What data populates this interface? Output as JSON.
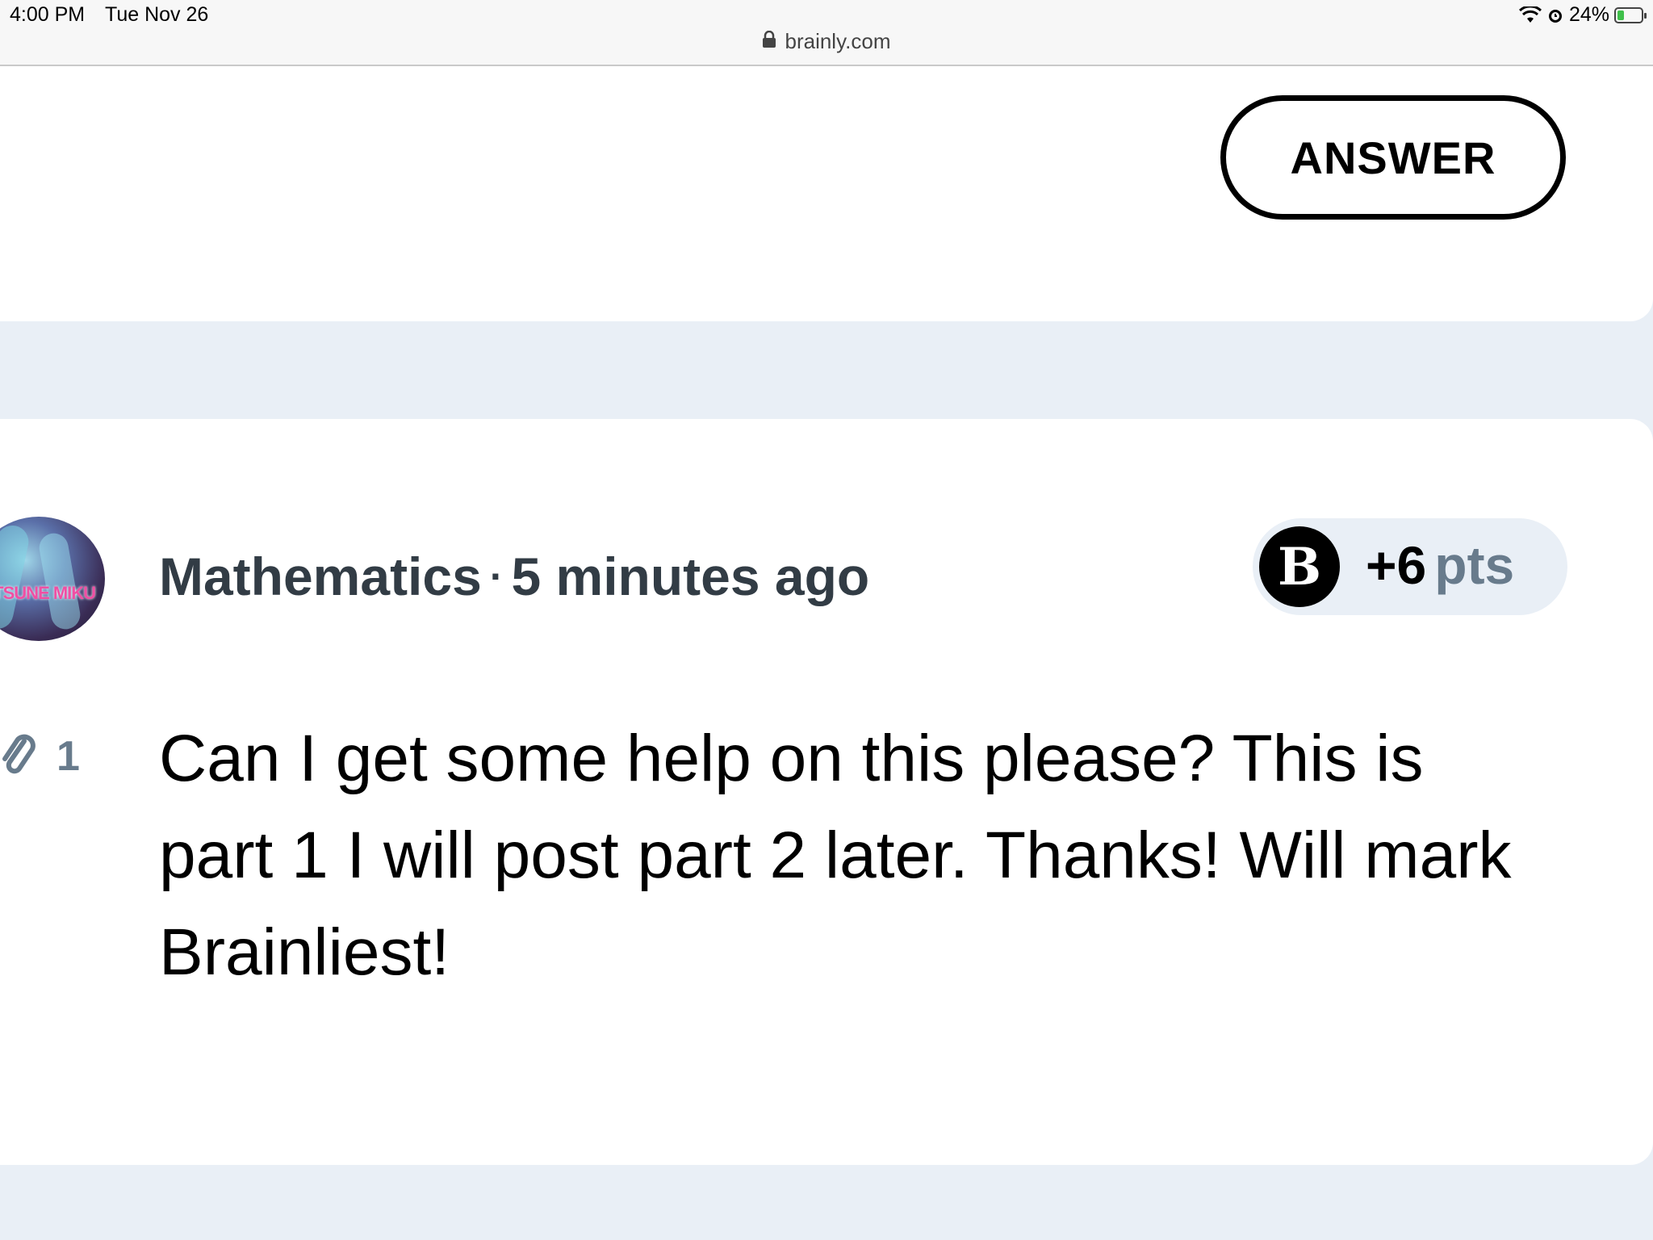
{
  "status_bar": {
    "time": "4:00 PM",
    "date": "Tue Nov 26",
    "battery": "24%",
    "icons": [
      "wifi-icon",
      "alarm-icon",
      "battery-charging-icon"
    ]
  },
  "address_bar": {
    "url": "brainly.com",
    "icon": "lock-icon"
  },
  "top_card": {
    "answer_label": "ANSWER"
  },
  "question": {
    "subject": "Mathematics",
    "separator": "·",
    "time_ago": "5 minutes ago",
    "avatar_text": "ATSUNE MIKU",
    "points_badge_letter": "B",
    "points_value": "+6",
    "points_unit": "pts",
    "attachments_count": "1",
    "text": "Can I get some help on this please? This is part 1 I will post part 2 later. Thanks! Will mark Brainliest!"
  },
  "colors": {
    "background": "#e9eff6",
    "card": "#ffffff",
    "meta_text": "#323c45",
    "muted": "#687b8c"
  }
}
